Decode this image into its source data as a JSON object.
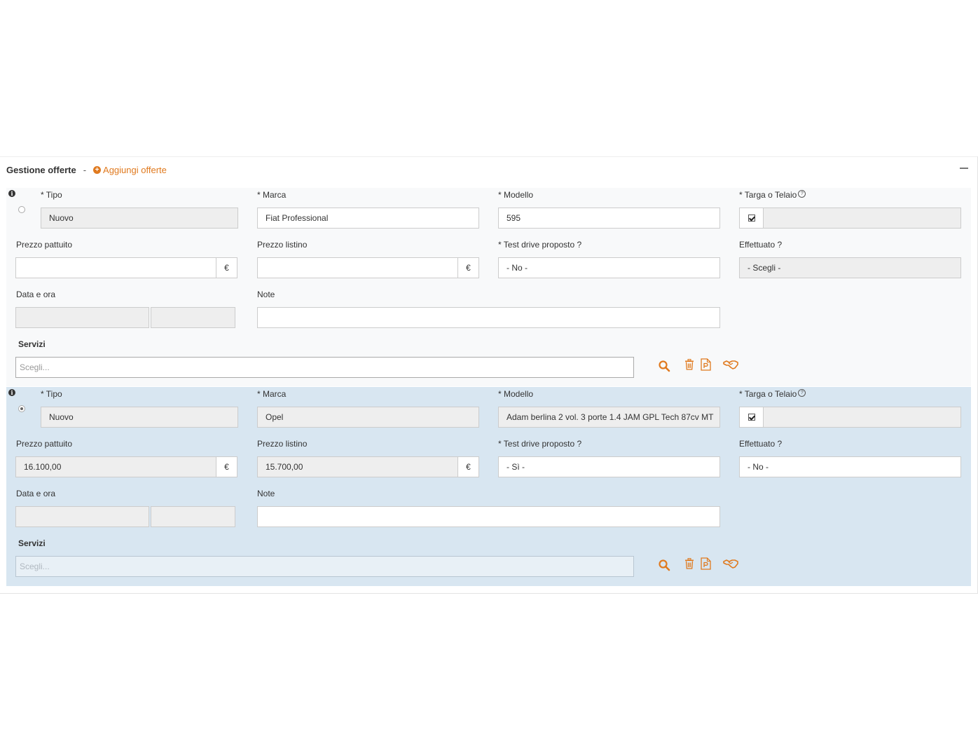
{
  "header": {
    "title": "Gestione offerte",
    "separator": "-",
    "add_label": "Aggiungi offerte"
  },
  "labels": {
    "tipo": "* Tipo",
    "marca": "* Marca",
    "modello": "* Modello",
    "targa": "* Targa o Telaio",
    "prezzo_pattuito": "Prezzo pattuito",
    "prezzo_listino": "Prezzo listino",
    "test_drive": "* Test drive proposto ?",
    "effettuato": "Effettuato ?",
    "data_ora": "Data e ora",
    "note": "Note",
    "servizi": "Servizi",
    "currency": "€",
    "help": "?"
  },
  "offers": [
    {
      "selected": false,
      "tipo": "Nuovo",
      "marca": "Fiat Professional",
      "modello": "595",
      "targa_checked": true,
      "targa": "",
      "prezzo_pattuito": "",
      "prezzo_listino": "",
      "test_drive": "- No -",
      "effettuato": "- Scegli -",
      "data": "",
      "ora": "",
      "note": "",
      "servizi_placeholder": "Scegli..."
    },
    {
      "selected": true,
      "tipo": "Nuovo",
      "marca": "Opel",
      "modello": "Adam berlina 2 vol. 3 porte 1.4 JAM GPL Tech 87cv MT",
      "targa_checked": true,
      "targa": "",
      "prezzo_pattuito": "16.100,00",
      "prezzo_listino": "15.700,00",
      "test_drive": "- Sì -",
      "effettuato": "- No -",
      "data": "",
      "ora": "",
      "note": "",
      "servizi_placeholder": "Scegli..."
    }
  ],
  "icons": {
    "search": "search-icon",
    "delete": "trash-icon",
    "pdf": "pdf-document-icon",
    "deal": "handshake-icon",
    "info": "info-icon",
    "help": "help-circle-icon",
    "add": "plus-circle-icon",
    "collapse": "minus-icon"
  },
  "colors": {
    "accent": "#e07a1f",
    "selected_row": "#d8e6f1",
    "row": "#f8f9fa",
    "disabled_field": "#eeeeee"
  }
}
